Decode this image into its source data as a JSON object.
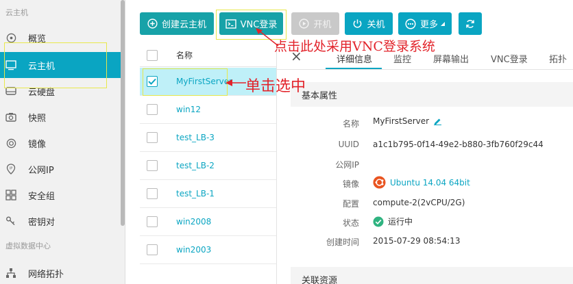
{
  "sidebar": {
    "section_cloud": "云主机",
    "section_vdc": "虚拟数据中心",
    "items": [
      {
        "label": "概览",
        "icon": "globe-icon"
      },
      {
        "label": "云主机",
        "icon": "monitor-icon"
      },
      {
        "label": "云硬盘",
        "icon": "disk-icon"
      },
      {
        "label": "快照",
        "icon": "camera-icon"
      },
      {
        "label": "镜像",
        "icon": "image-icon"
      },
      {
        "label": "公网IP",
        "icon": "ip-icon"
      },
      {
        "label": "安全组",
        "icon": "security-group-icon"
      },
      {
        "label": "密钥对",
        "icon": "key-icon"
      },
      {
        "label": "网络拓扑",
        "icon": "topology-icon"
      }
    ]
  },
  "toolbar": {
    "create_label": "创建云主机",
    "vnc_label": "VNC登录",
    "start_label": "开机",
    "shutdown_label": "关机",
    "more_label": "更多"
  },
  "list": {
    "header_label": "名称",
    "rows": [
      {
        "name": "MyFirstServer",
        "selected": true
      },
      {
        "name": "win12",
        "selected": false
      },
      {
        "name": "test_LB-3",
        "selected": false
      },
      {
        "name": "test_LB-2",
        "selected": false
      },
      {
        "name": "test_LB-1",
        "selected": false
      },
      {
        "name": "win2008",
        "selected": false
      },
      {
        "name": "win2003",
        "selected": false
      }
    ]
  },
  "tabs": [
    "详细信息",
    "监控",
    "屏幕输出",
    "VNC登录",
    "拓扑"
  ],
  "details": {
    "section_title": "基本属性",
    "labels": {
      "name": "名称",
      "uuid": "UUID",
      "public_ip": "公网IP",
      "image": "镜像",
      "config": "配置",
      "status": "状态",
      "created": "创建时间"
    },
    "values": {
      "name": "MyFirstServer",
      "uuid": "a1c1b795-0f14-49e2-b880-3fb760f29c44",
      "public_ip": "",
      "image": "Ubuntu 14.04 64bit",
      "config": "compute-2(2vCPU/2G)",
      "status": "运行中",
      "created": "2015-07-29 08:54:13"
    },
    "related_title": "关联资源"
  },
  "annotations": {
    "vnc_hint": "点击此处采用VNC登录系统",
    "select_hint": "单击选中"
  },
  "colors": {
    "accent": "#0aa5c2",
    "teal": "#17a2a8",
    "annotation": "#e2232a",
    "status_green": "#2fb380",
    "ubuntu_orange": "#e95420"
  }
}
